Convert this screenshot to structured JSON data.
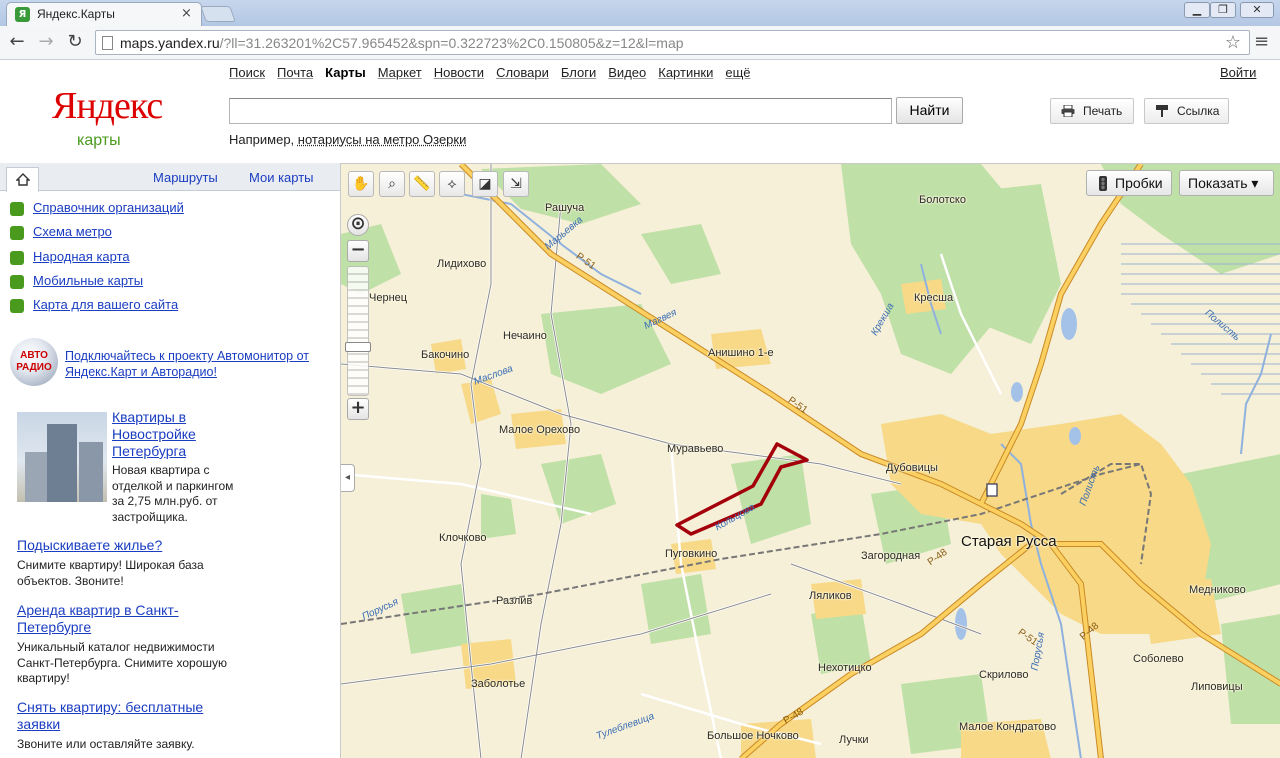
{
  "browser": {
    "tab_title": "Яндекс.Карты",
    "tab_close": "×",
    "url_host": "maps.yandex.ru",
    "url_path": "/?ll=31.263201%2C57.965452&spn=0.322723%2C0.150805&z=12&l=map",
    "back_glyph": "←",
    "forward_glyph": "→",
    "reload_glyph": "↻",
    "star_glyph": "☆",
    "menu_glyph": "≡",
    "minimize_glyph": "▁",
    "maximize_glyph": "❐",
    "close_glyph": "✕"
  },
  "header": {
    "logo": "Яндекс",
    "logo_sub": "карты",
    "services": [
      "Поиск",
      "Почта",
      "Карты",
      "Маркет",
      "Новости",
      "Словари",
      "Блоги",
      "Видео",
      "Картинки",
      "ещё"
    ],
    "current_service": "Карты",
    "login": "Войти",
    "search_value": "",
    "search_button": "Найти",
    "example_prefix": "Например, ",
    "example_link": "нотариусы на метро Озерки",
    "print_button": "Печать",
    "link_button": "Ссылка"
  },
  "sidebar": {
    "tabs": [
      "Маршруты",
      "Мои карты"
    ],
    "links": [
      {
        "label": "Справочник организаций",
        "color": "#4a9a1e"
      },
      {
        "label": "Схема метро",
        "color": "#4a9a1e"
      },
      {
        "label": "Народная карта",
        "color": "#4a9a1e"
      },
      {
        "label": "Мобильные карты",
        "color": "#4a9a1e"
      },
      {
        "label": "Карта для вашего сайта",
        "color": "#4a9a1e"
      }
    ],
    "auto_logo": "АВТО РАДИО",
    "auto_text": "Подключайтесь к проекту Автомонитор от Яндекс.Карт и Авторадио!",
    "ads": [
      {
        "title": "Квартиры в Новостройке Петербурга",
        "text": "Новая квартира с отделкой и паркингом за 2,75 млн.руб. от застройщика."
      },
      {
        "title": "Подыскиваете жилье?",
        "text": "Снимите квартиру! Широкая база объектов. Звоните!"
      },
      {
        "title": "Аренда квартир в Санкт-Петербурге",
        "text": "Уникальный каталог недвижимости Санкт-Петербурга. Снимите хорошую квартиру!"
      },
      {
        "title": "Снять квартиру: бесплатные заявки",
        "text": "Звоните или оставляйте заявку."
      }
    ]
  },
  "map": {
    "traffic_button": "Пробки",
    "show_button": "Показать ▾",
    "zoom_in": "+",
    "zoom_out": "−",
    "collapse": "◂",
    "places": [
      "Рашуча",
      "Болотско",
      "Лидихово",
      "Чернец",
      "Нечаино",
      "Кресша",
      "Бакочино",
      "Анишино 1-е",
      "Малое Орехово",
      "Муравьево",
      "Дубовицы",
      "Старая Русса",
      "Клочково",
      "Пуговкино",
      "Загородная",
      "Ляликов",
      "Медниково",
      "Разлив",
      "Заболотье",
      "Нехотицко",
      "Скрилово",
      "Соболево",
      "Липовицы",
      "Большое Ночково",
      "Лучки",
      "Малое Кондратово"
    ],
    "road_labels": [
      "Р-51",
      "Р-51",
      "Р-48",
      "Р-48",
      "Р-48",
      "Р-51"
    ],
    "water_labels": [
      "Марьевка",
      "Магвея",
      "Маслова",
      "Крекша",
      "Полисть",
      "Порусья",
      "Полисть",
      "Кольцова",
      "Тулеблевица",
      "Порусья"
    ]
  }
}
